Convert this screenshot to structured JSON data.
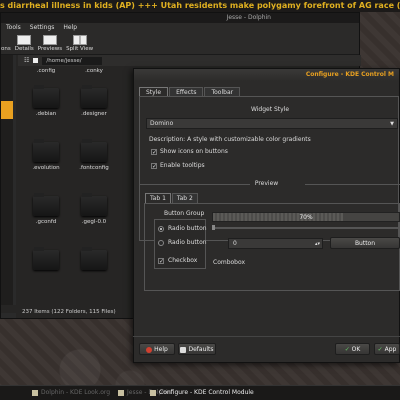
{
  "ticker": {
    "text": "s diarrheal illness in kids (AP) +++ Utah residents make polygamy forefront of AG race (AP) +++ Official: 11 killed in Pak"
  },
  "dolphin": {
    "title": "Jesse - Dolphin",
    "menu": [
      "Tools",
      "Settings",
      "Help"
    ],
    "toolbar": [
      {
        "label": "ons"
      },
      {
        "label": "Details"
      },
      {
        "label": "Previews"
      },
      {
        "label": "Split View"
      }
    ],
    "location": "/home/jesse/",
    "files": [
      ".config",
      ".conky",
      ".debian",
      ".designer",
      ".evolution",
      ".fontconfig",
      ".gconfd",
      ".gegl-0.0"
    ],
    "status": "237 Items (122 Folders, 115 Files)"
  },
  "dialog": {
    "title": "Configure - KDE Control M",
    "tabs": [
      "Style",
      "Effects",
      "Toolbar"
    ],
    "widget_style_label": "Widget Style",
    "widget_style_value": "Domino",
    "description": "Description: A style with customizable color gradients",
    "show_icons": "Show icons on buttons",
    "enable_tooltips": "Enable tooltips",
    "preview_label": "Preview",
    "inner_tabs": [
      "Tab 1",
      "Tab 2"
    ],
    "button_group": "Button Group",
    "radio1": "Radio button",
    "radio2": "Radio button",
    "checkbox": "Checkbox",
    "progress_text": "70%",
    "progress_value": 0.7,
    "spin_value": "0",
    "button_label": "Button",
    "combobox": "Combobox",
    "help": "Help",
    "defaults": "Defaults",
    "ok": "OK",
    "apply": "App"
  },
  "taskbar": {
    "items": [
      "Dolphin - KDE Look.org",
      "Jesse - Dolphin",
      "Configure - KDE Control Module"
    ]
  }
}
